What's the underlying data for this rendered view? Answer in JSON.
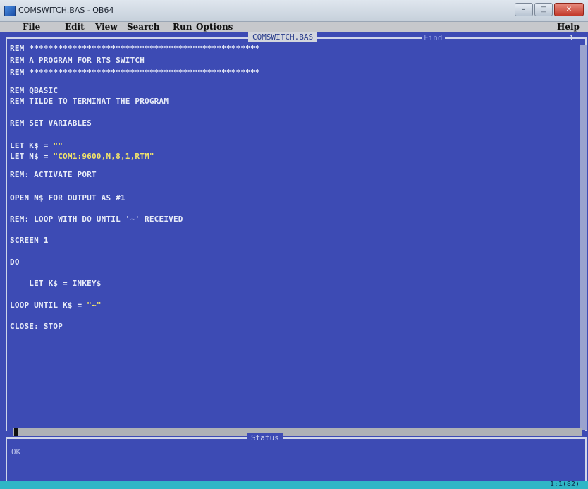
{
  "window": {
    "title": "COMSWITCH.BAS - QB64",
    "minimize": "–",
    "maximize": "□",
    "close": "✕"
  },
  "menu": {
    "items": [
      "File",
      "Edit",
      "View",
      "Search",
      "Run",
      "Options"
    ],
    "help": "Help"
  },
  "editor": {
    "filename": "COMSWITCH.BAS",
    "find_label": "Find",
    "position_indicator": "4",
    "lines": [
      "REM ************************************************",
      "REM A PROGRAM FOR RTS SWITCH",
      "REM ************************************************",
      "REM QBASIC",
      "REM TILDE TO TERMINAT THE PROGRAM",
      "REM SET VARIABLES",
      "LET K$ = \"\"",
      "LET N$ = \"COM1:9600,N,8,1,RTM\"",
      "REM: ACTIVATE PORT",
      "OPEN N$ FOR OUTPUT AS #1",
      "REM: LOOP WITH DO UNTIL '~' RECEIVED",
      "SCREEN 1",
      "DO",
      "    LET K$ = INKEY$",
      "LOOP UNTIL K$ = \"~\"",
      "CLOSE: STOP"
    ]
  },
  "status": {
    "label": "Status",
    "text": "OK"
  },
  "footer": {
    "cursor": "1:1(82)"
  },
  "colors": {
    "background": "#3d4bb4",
    "text": "#e8ecf8",
    "string": "#f2e46a",
    "bottom_bar": "#30b6c6"
  }
}
